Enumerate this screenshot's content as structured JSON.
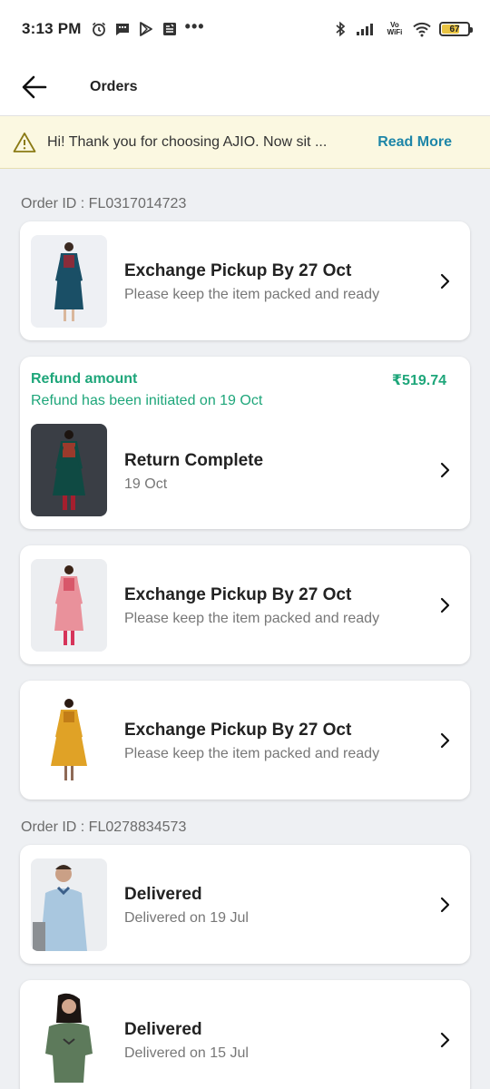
{
  "status_bar": {
    "time": "3:13 PM",
    "vowifi": "Vo WiFi",
    "battery_level": "67",
    "battery_fraction": 0.67,
    "left_icons": [
      "alarm-icon",
      "chat-icon",
      "play-store-icon",
      "news-icon"
    ],
    "right_icons": [
      "bluetooth-icon",
      "signal-icon",
      "vowifi-icon",
      "wifi-icon",
      "battery-icon"
    ]
  },
  "header": {
    "title": "Orders",
    "back_icon": "arrow-left-icon"
  },
  "notice": {
    "icon": "warning-icon",
    "message": "Hi! Thank you for choosing AJIO. Now sit ...",
    "action": "Read More",
    "accent": "#1e86a8",
    "background": "#fbf8e1"
  },
  "orders": [
    {
      "order_id_label": "Order ID : FL0317014723",
      "items": [
        {
          "status": "Exchange Pickup By 27 Oct",
          "detail": "Please keep the item packed and ready",
          "image": "teal-kurta"
        },
        {
          "refund_label": "Refund amount",
          "refund_amount": "₹519.74",
          "refund_note": "Refund has been initiated on 19 Oct",
          "status": "Return Complete",
          "detail": "19 Oct",
          "image": "green-kurta"
        },
        {
          "status": "Exchange Pickup By 27 Oct",
          "detail": "Please keep the item packed and ready",
          "image": "pink-kurta"
        },
        {
          "status": "Exchange Pickup By 27 Oct",
          "detail": "Please keep the item packed and ready",
          "image": "mustard-kurta"
        }
      ]
    },
    {
      "order_id_label": "Order ID : FL0278834573",
      "items": [
        {
          "status": "Delivered",
          "detail": "Delivered on 19 Jul",
          "image": "blue-shirt"
        },
        {
          "status": "Delivered",
          "detail": "Delivered on 15 Jul",
          "image": "olive-tshirt"
        }
      ]
    }
  ],
  "colors": {
    "refund_green": "#1ea67a",
    "page_background": "#eef0f3"
  },
  "chevron_icon": "chevron-right-icon"
}
